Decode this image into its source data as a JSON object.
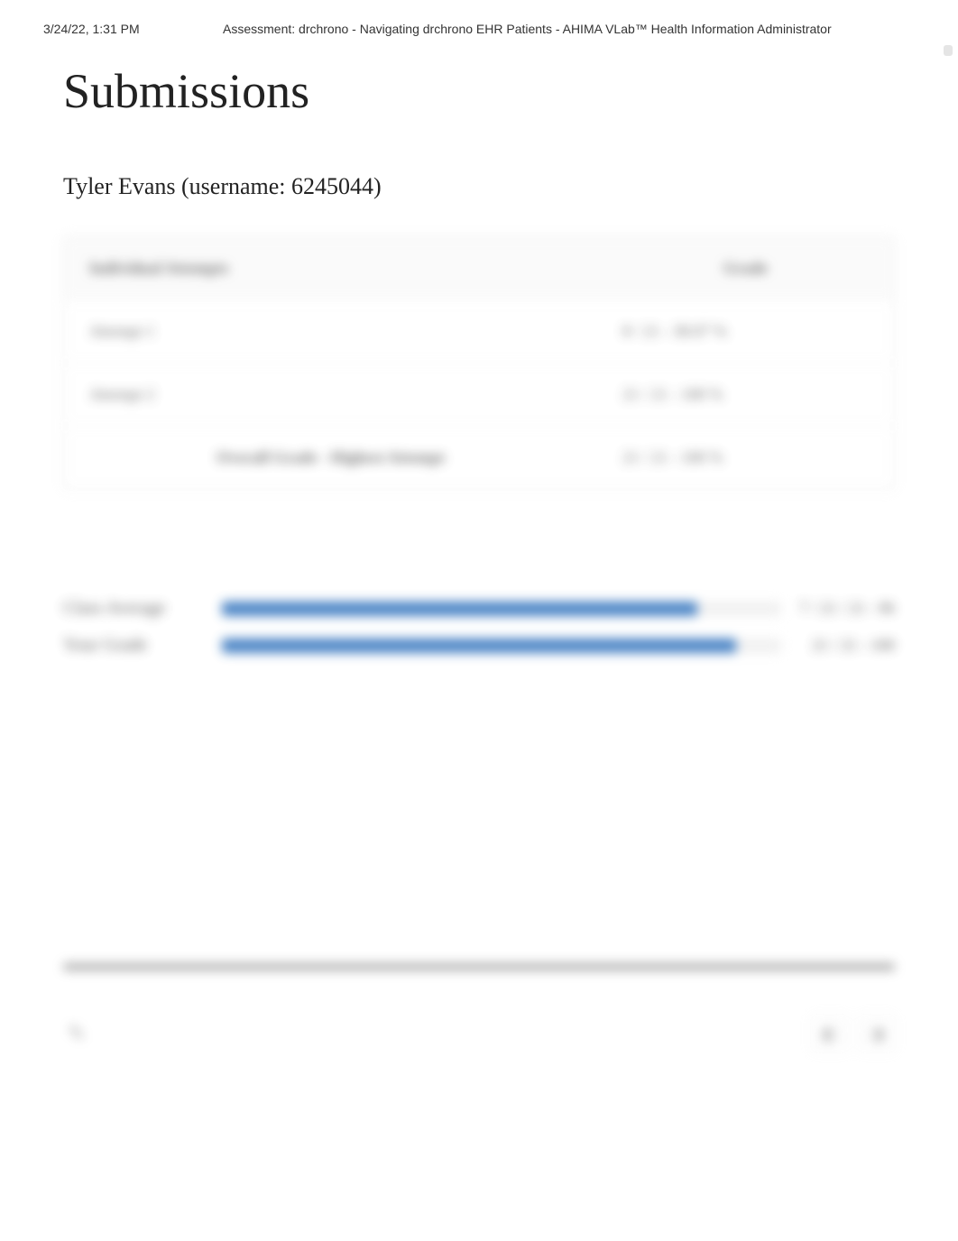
{
  "print_header": {
    "timestamp": "3/24/22, 1:31 PM",
    "title": "Assessment: drchrono - Navigating drchrono EHR Patients - AHIMA VLab™ Health Information Administrator"
  },
  "page": {
    "title": "Submissions",
    "user_line": "Tyler Evans (username: 6245044)"
  },
  "table": {
    "headers": [
      "Individual Attempts",
      "Grade"
    ],
    "rows": [
      {
        "attempt": "Attempt 1",
        "grade": "8 / 21 - 38.07 %"
      },
      {
        "attempt": "Attempt 2",
        "grade": "21 / 21 - 100 %"
      }
    ],
    "overall": {
      "label": "Overall Grade - Highest Attempt",
      "grade": "21 / 21 - 100 %"
    }
  },
  "grades": {
    "class_avg": {
      "label": "Class Average",
      "value": "7 / 21 / 21 - 96",
      "pct": 85
    },
    "your_grade": {
      "label": "Your Grade",
      "value": "21 / 21 - 100",
      "pct": 92
    }
  },
  "footer": {
    "icon_left": "✎",
    "icon_r1": "◧",
    "icon_r2": "◨"
  }
}
